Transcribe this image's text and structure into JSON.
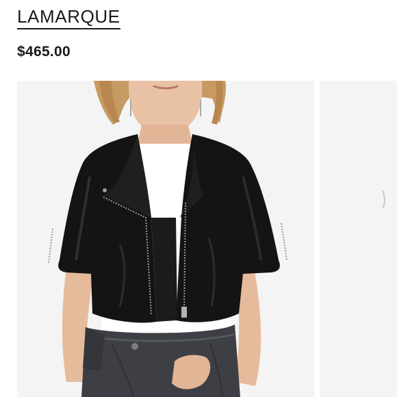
{
  "product": {
    "brand": "LAMARQUE",
    "price": "$465.00"
  },
  "gallery": {
    "main_photo_subject": "model-wearing-cropped-black-leather-moto-jacket",
    "next_photo_subject": "next-product-photo-partial"
  },
  "colors": {
    "text": "#1a1a1a",
    "photo_background": "#f4f4f4",
    "jacket": "#141414",
    "jeans": "#3d3f44"
  }
}
